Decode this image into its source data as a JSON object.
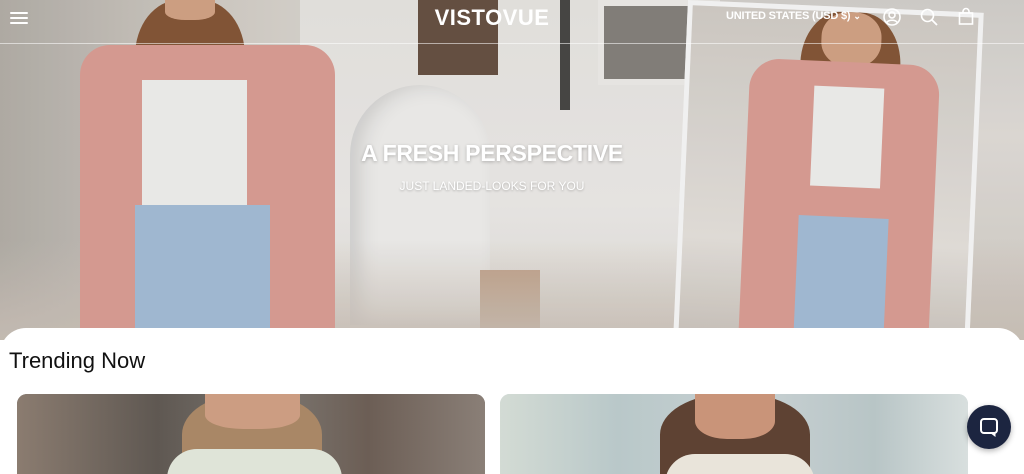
{
  "header": {
    "logo": "VISTOVUE",
    "currency": "UNITED STATES (USD $)",
    "icons": [
      "menu-icon",
      "account-icon",
      "search-icon",
      "cart-icon",
      "chevron-down-icon"
    ]
  },
  "hero": {
    "title": "A FRESH PERSPECTIVE",
    "subtitle": "JUST LANDED-LOOKS FOR YOU"
  },
  "trending": {
    "title": "Trending Now"
  },
  "chat": {
    "icon": "chat-icon",
    "color": "#1c2540"
  }
}
